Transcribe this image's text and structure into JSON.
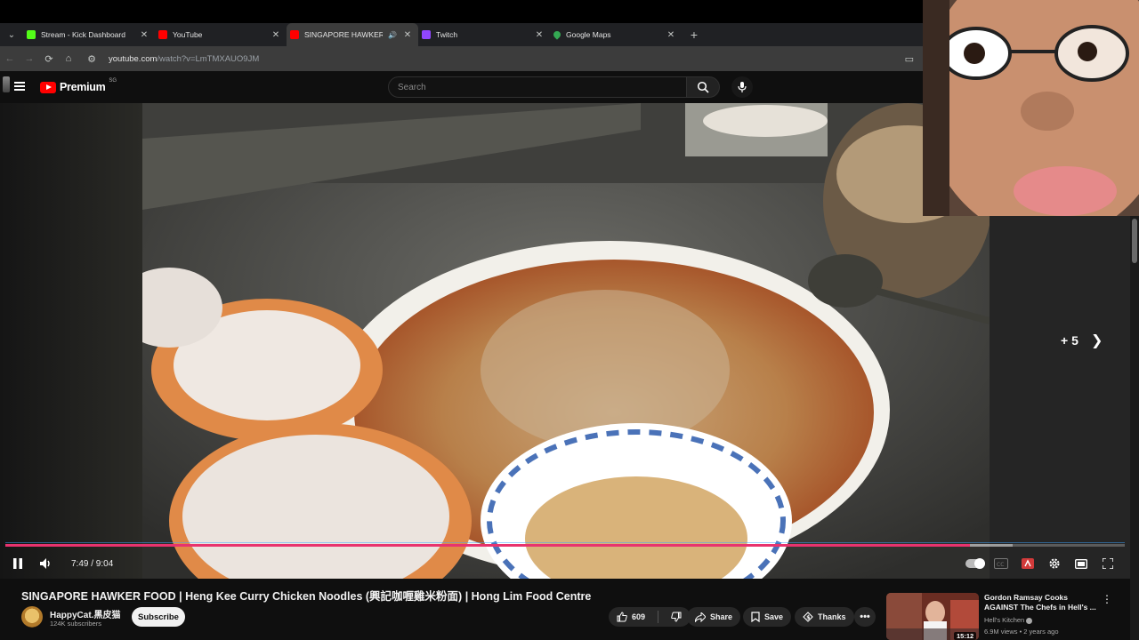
{
  "browser": {
    "tabs": [
      {
        "title": "Stream - Kick Dashboard",
        "favicon": "kick-icon",
        "color": "#53fc18",
        "active": false
      },
      {
        "title": "YouTube",
        "favicon": "youtube-icon",
        "color": "#ff0000",
        "active": false
      },
      {
        "title": "SINGAPORE HAWKER FOOD",
        "favicon": "youtube-icon",
        "color": "#ff0000",
        "active": true
      },
      {
        "title": "Twitch",
        "favicon": "twitch-icon",
        "color": "#9146ff",
        "active": false
      },
      {
        "title": "Google Maps",
        "favicon": "maps-icon",
        "color": "#34a853",
        "active": false
      }
    ],
    "url_host": "youtube.com",
    "url_path": "/watch?v=LmTMXAUO9JM"
  },
  "youtube": {
    "brand": "Premium",
    "country": "SG",
    "search_placeholder": "Search"
  },
  "player": {
    "time": "7:49 / 9:04",
    "progress_fraction": 0.862,
    "buffered_fraction": 0.9,
    "next_label": "+ 5"
  },
  "video": {
    "title": "SINGAPORE HAWKER FOOD | Heng Kee Curry Chicken Noodles (興記咖喱雞米粉面) | Hong Lim Food Centre",
    "channel": "HappyCat.黑皮猫",
    "subscribers": "124K subscribers",
    "subscribe_label": "Subscribe",
    "likes": "609",
    "share_label": "Share",
    "save_label": "Save",
    "thanks_label": "Thanks"
  },
  "recommended": {
    "title": "Gordon Ramsay Cooks AGAINST The Chefs in Hell's ...",
    "channel": "Hell's Kitchen",
    "meta": "6.9M views • 2 years ago",
    "duration": "15:12"
  },
  "colors": {
    "progress": "#e8336e",
    "youtube_red": "#ff0000"
  }
}
